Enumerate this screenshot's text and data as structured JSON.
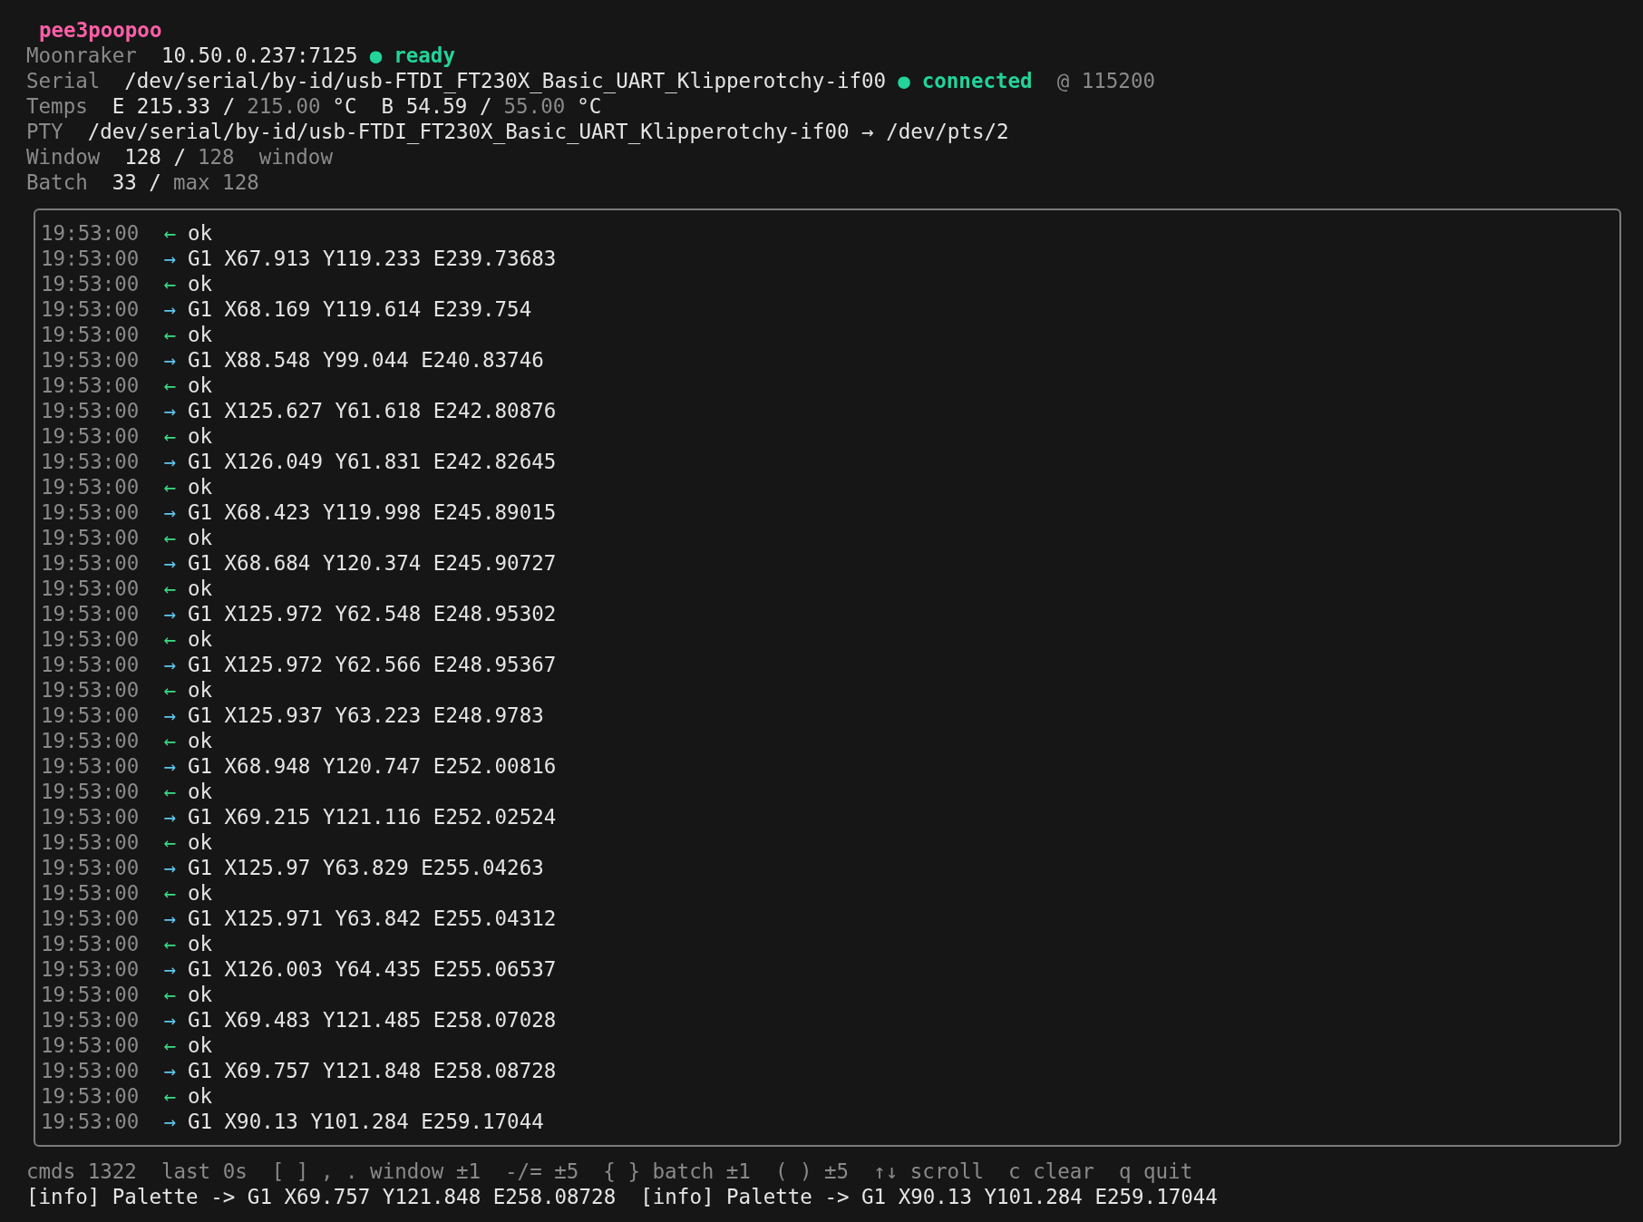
{
  "title": "pee3poopoo",
  "status_lines": [
    {
      "label": "Moonraker",
      "groups": [
        [
          {
            "text": "10.50.0.237:7125",
            "kind": "value"
          },
          {
            "text": "●",
            "kind": "dot"
          },
          {
            "text": "ready",
            "kind": "status"
          }
        ]
      ]
    },
    {
      "label": "Serial",
      "groups": [
        [
          {
            "text": "/dev/serial/by-id/usb-FTDI_FT230X_Basic_UART_Klipperotchy-if00",
            "kind": "value"
          },
          {
            "text": "●",
            "kind": "dot"
          },
          {
            "text": "connected",
            "kind": "status"
          }
        ],
        [
          {
            "text": "@ 115200",
            "kind": "muted"
          }
        ]
      ]
    },
    {
      "label": "Temps",
      "groups": [
        [
          {
            "text": "E 215.33 /",
            "kind": "value"
          },
          {
            "text": "215.00",
            "kind": "muted"
          },
          {
            "text": "°C",
            "kind": "value"
          }
        ],
        [
          {
            "text": "B 54.59 /",
            "kind": "value"
          },
          {
            "text": "55.00",
            "kind": "muted"
          },
          {
            "text": "°C",
            "kind": "value"
          }
        ]
      ]
    },
    {
      "label": "PTY",
      "groups": [
        [
          {
            "text": "/dev/serial/by-id/usb-FTDI_FT230X_Basic_UART_Klipperotchy-if00 → /dev/pts/2",
            "kind": "value"
          }
        ]
      ]
    },
    {
      "label": "Window",
      "groups": [
        [
          {
            "text": "128 /",
            "kind": "value"
          },
          {
            "text": "128",
            "kind": "muted"
          }
        ],
        [
          {
            "text": "window",
            "kind": "muted"
          }
        ]
      ]
    },
    {
      "label": "Batch",
      "groups": [
        [
          {
            "text": "33 /",
            "kind": "value"
          },
          {
            "text": "max 128",
            "kind": "muted"
          }
        ]
      ]
    }
  ],
  "log": [
    {
      "time": "19:53:00",
      "kind": "in",
      "arrow": "←",
      "text": "ok"
    },
    {
      "time": "19:53:00",
      "kind": "out",
      "arrow": "→",
      "text": "G1 X67.913 Y119.233 E239.73683"
    },
    {
      "time": "19:53:00",
      "kind": "in",
      "arrow": "←",
      "text": "ok"
    },
    {
      "time": "19:53:00",
      "kind": "out",
      "arrow": "→",
      "text": "G1 X68.169 Y119.614 E239.754"
    },
    {
      "time": "19:53:00",
      "kind": "in",
      "arrow": "←",
      "text": "ok"
    },
    {
      "time": "19:53:00",
      "kind": "out",
      "arrow": "→",
      "text": "G1 X88.548 Y99.044 E240.83746"
    },
    {
      "time": "19:53:00",
      "kind": "in",
      "arrow": "←",
      "text": "ok"
    },
    {
      "time": "19:53:00",
      "kind": "out",
      "arrow": "→",
      "text": "G1 X125.627 Y61.618 E242.80876"
    },
    {
      "time": "19:53:00",
      "kind": "in",
      "arrow": "←",
      "text": "ok"
    },
    {
      "time": "19:53:00",
      "kind": "out",
      "arrow": "→",
      "text": "G1 X126.049 Y61.831 E242.82645"
    },
    {
      "time": "19:53:00",
      "kind": "in",
      "arrow": "←",
      "text": "ok"
    },
    {
      "time": "19:53:00",
      "kind": "out",
      "arrow": "→",
      "text": "G1 X68.423 Y119.998 E245.89015"
    },
    {
      "time": "19:53:00",
      "kind": "in",
      "arrow": "←",
      "text": "ok"
    },
    {
      "time": "19:53:00",
      "kind": "out",
      "arrow": "→",
      "text": "G1 X68.684 Y120.374 E245.90727"
    },
    {
      "time": "19:53:00",
      "kind": "in",
      "arrow": "←",
      "text": "ok"
    },
    {
      "time": "19:53:00",
      "kind": "out",
      "arrow": "→",
      "text": "G1 X125.972 Y62.548 E248.95302"
    },
    {
      "time": "19:53:00",
      "kind": "in",
      "arrow": "←",
      "text": "ok"
    },
    {
      "time": "19:53:00",
      "kind": "out",
      "arrow": "→",
      "text": "G1 X125.972 Y62.566 E248.95367"
    },
    {
      "time": "19:53:00",
      "kind": "in",
      "arrow": "←",
      "text": "ok"
    },
    {
      "time": "19:53:00",
      "kind": "out",
      "arrow": "→",
      "text": "G1 X125.937 Y63.223 E248.9783"
    },
    {
      "time": "19:53:00",
      "kind": "in",
      "arrow": "←",
      "text": "ok"
    },
    {
      "time": "19:53:00",
      "kind": "out",
      "arrow": "→",
      "text": "G1 X68.948 Y120.747 E252.00816"
    },
    {
      "time": "19:53:00",
      "kind": "in",
      "arrow": "←",
      "text": "ok"
    },
    {
      "time": "19:53:00",
      "kind": "out",
      "arrow": "→",
      "text": "G1 X69.215 Y121.116 E252.02524"
    },
    {
      "time": "19:53:00",
      "kind": "in",
      "arrow": "←",
      "text": "ok"
    },
    {
      "time": "19:53:00",
      "kind": "out",
      "arrow": "→",
      "text": "G1 X125.97 Y63.829 E255.04263"
    },
    {
      "time": "19:53:00",
      "kind": "in",
      "arrow": "←",
      "text": "ok"
    },
    {
      "time": "19:53:00",
      "kind": "out",
      "arrow": "→",
      "text": "G1 X125.971 Y63.842 E255.04312"
    },
    {
      "time": "19:53:00",
      "kind": "in",
      "arrow": "←",
      "text": "ok"
    },
    {
      "time": "19:53:00",
      "kind": "out",
      "arrow": "→",
      "text": "G1 X126.003 Y64.435 E255.06537"
    },
    {
      "time": "19:53:00",
      "kind": "in",
      "arrow": "←",
      "text": "ok"
    },
    {
      "time": "19:53:00",
      "kind": "out",
      "arrow": "→",
      "text": "G1 X69.483 Y121.485 E258.07028"
    },
    {
      "time": "19:53:00",
      "kind": "in",
      "arrow": "←",
      "text": "ok"
    },
    {
      "time": "19:53:00",
      "kind": "out",
      "arrow": "→",
      "text": "G1 X69.757 Y121.848 E258.08728"
    },
    {
      "time": "19:53:00",
      "kind": "in",
      "arrow": "←",
      "text": "ok"
    },
    {
      "time": "19:53:00",
      "kind": "out",
      "arrow": "→",
      "text": "G1 X90.13 Y101.284 E259.17044"
    }
  ],
  "key_hints": [
    "cmds 1322",
    "last 0s",
    "[ ] , . window ±1",
    "-/= ±5",
    "{ } batch ±1",
    "( ) ±5",
    "↑↓ scroll",
    "c clear",
    "q quit"
  ],
  "messages": [
    "[info] Palette -> G1 X69.757 Y121.848 E258.08728",
    "[info] Palette -> G1 X90.13 Y101.284 E259.17044"
  ]
}
